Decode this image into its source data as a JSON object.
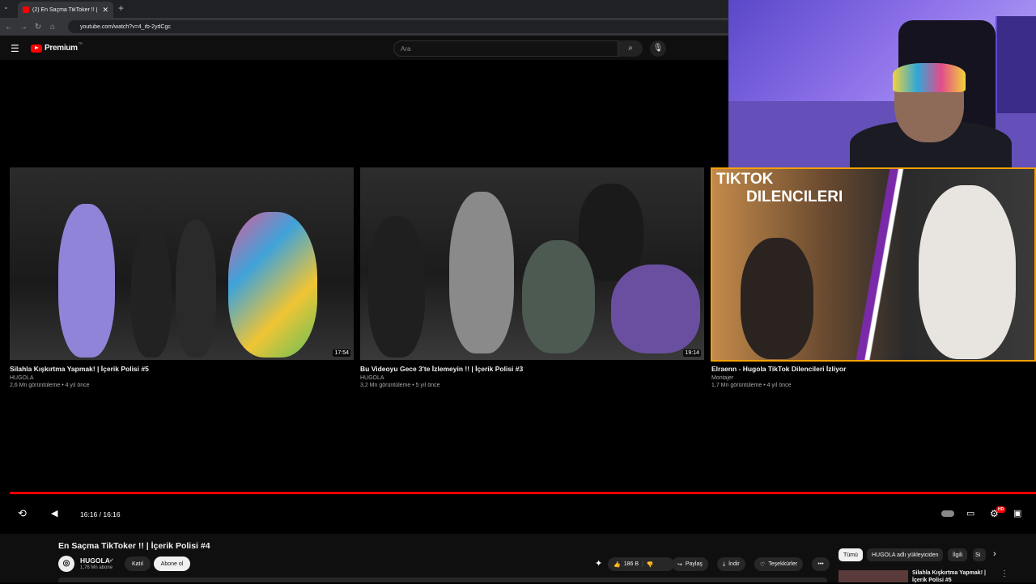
{
  "browser": {
    "tab_title": "(2) En Saçma TikToker !! | İçerik",
    "url": "youtube.com/watch?v=4_rb-2ydCgc"
  },
  "header": {
    "logo_text": "Premium",
    "logo_sup": "TR",
    "search_placeholder": "Ara"
  },
  "endscreen": {
    "videos": [
      {
        "title": "Silahla Kışkırtma Yapmak! | İçerik Polisi #5",
        "channel": "HUGOLA",
        "meta": "2,6 Mn görüntüleme • 4 yıl önce",
        "duration": "17:54"
      },
      {
        "title": "Bu Videoyu Gece 3'te İzlemeyin !! | İçerik Polisi #3",
        "channel": "HUGOLA",
        "meta": "3,2 Mn görüntüleme • 5 yıl önce",
        "duration": "19:14"
      },
      {
        "title": "Elraenn - Hugola TikTok Dilencileri İzliyor",
        "channel": "Montajer",
        "meta": "1,7 Mn görüntüleme • 4 yıl önce",
        "thumb_text_1": "TIKTOK",
        "thumb_text_2": "DILENCILERI"
      }
    ]
  },
  "player": {
    "time": "16:16 / 16:16",
    "hd_badge": "HD"
  },
  "video": {
    "title": "En Saçma TikToker !! | İçerik Polisi #4",
    "channel": "HUGOLA",
    "subscribers": "1,76 Mn abone",
    "join_label": "Katıl",
    "subscribe_label": "Abone ol",
    "likes": "186 B",
    "share_label": "Paylaş",
    "download_label": "İndir",
    "thanks_label": "Teşekkürler",
    "more_label": "•••"
  },
  "filters": [
    "Tümü",
    "HUGOLA adlı yükleyiciden",
    "İlgili",
    "Si"
  ],
  "side_video": {
    "title": "Silahla Kışkırtma Yapmak! | İçerik Polisi #5"
  }
}
